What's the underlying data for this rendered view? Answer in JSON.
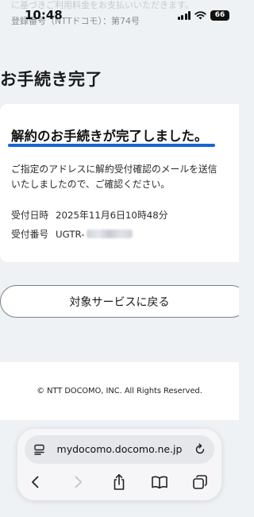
{
  "status_bar": {
    "time": "10:48",
    "battery": "66"
  },
  "top": {
    "faded_text": "に基づきご利用料金をお支払いいただきます。",
    "registration": "登録番号（NTTドコモ）：第74号"
  },
  "section_title": "お手続き完了",
  "card": {
    "heading": "解約のお手続きが完了しました。",
    "description": "ご指定のアドレスに解約受付確認のメールを送信いたしましたので、ご確認ください。",
    "rows": [
      {
        "label": "受付日時",
        "value": "2025年11月6日10時48分"
      },
      {
        "label": "受付番号",
        "value": "UGTR-"
      }
    ]
  },
  "back_button_label": "対象サービスに戻る",
  "footer_text": "© NTT DOCOMO, INC. All Rights Reserved.",
  "browser": {
    "url": "mydocomo.docomo.ne.jp",
    "icons": [
      "page-menu-icon",
      "reload-icon",
      "back-icon",
      "forward-icon",
      "share-icon",
      "bookmarks-icon",
      "tabs-icon"
    ]
  },
  "colors": {
    "accent_underline": "#1565d8",
    "background": "#eef2f5",
    "card": "#ffffff"
  }
}
